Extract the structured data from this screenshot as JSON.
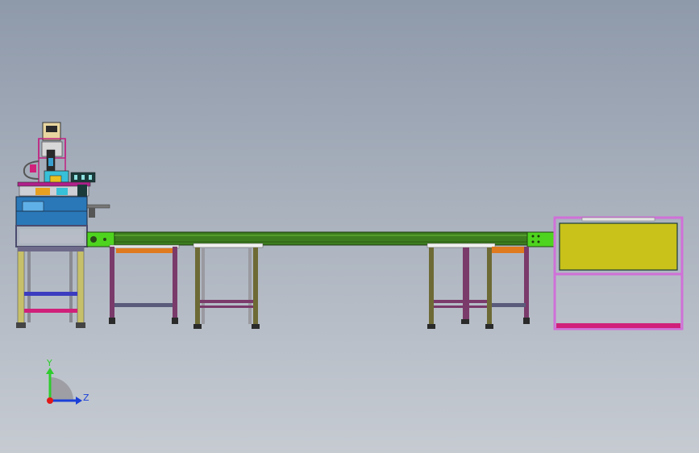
{
  "triad": {
    "y_label": "Y",
    "z_label": "Z",
    "y_color": "#2ecc2e",
    "z_color": "#1a3fd8",
    "x_color": "#e01818"
  },
  "colors": {
    "frame_purple": "#7a3a6a",
    "frame_olive": "#6e6a35",
    "belt_green": "#3d7d1f",
    "belt_light": "#6bbf3a",
    "accent_lime": "#4ed41e",
    "accent_orange": "#e07a1e",
    "panel_yellow": "#c8c21a",
    "frame_pink": "#d070d8",
    "station_blue": "#2a78b8",
    "station_magenta": "#d0207a"
  }
}
